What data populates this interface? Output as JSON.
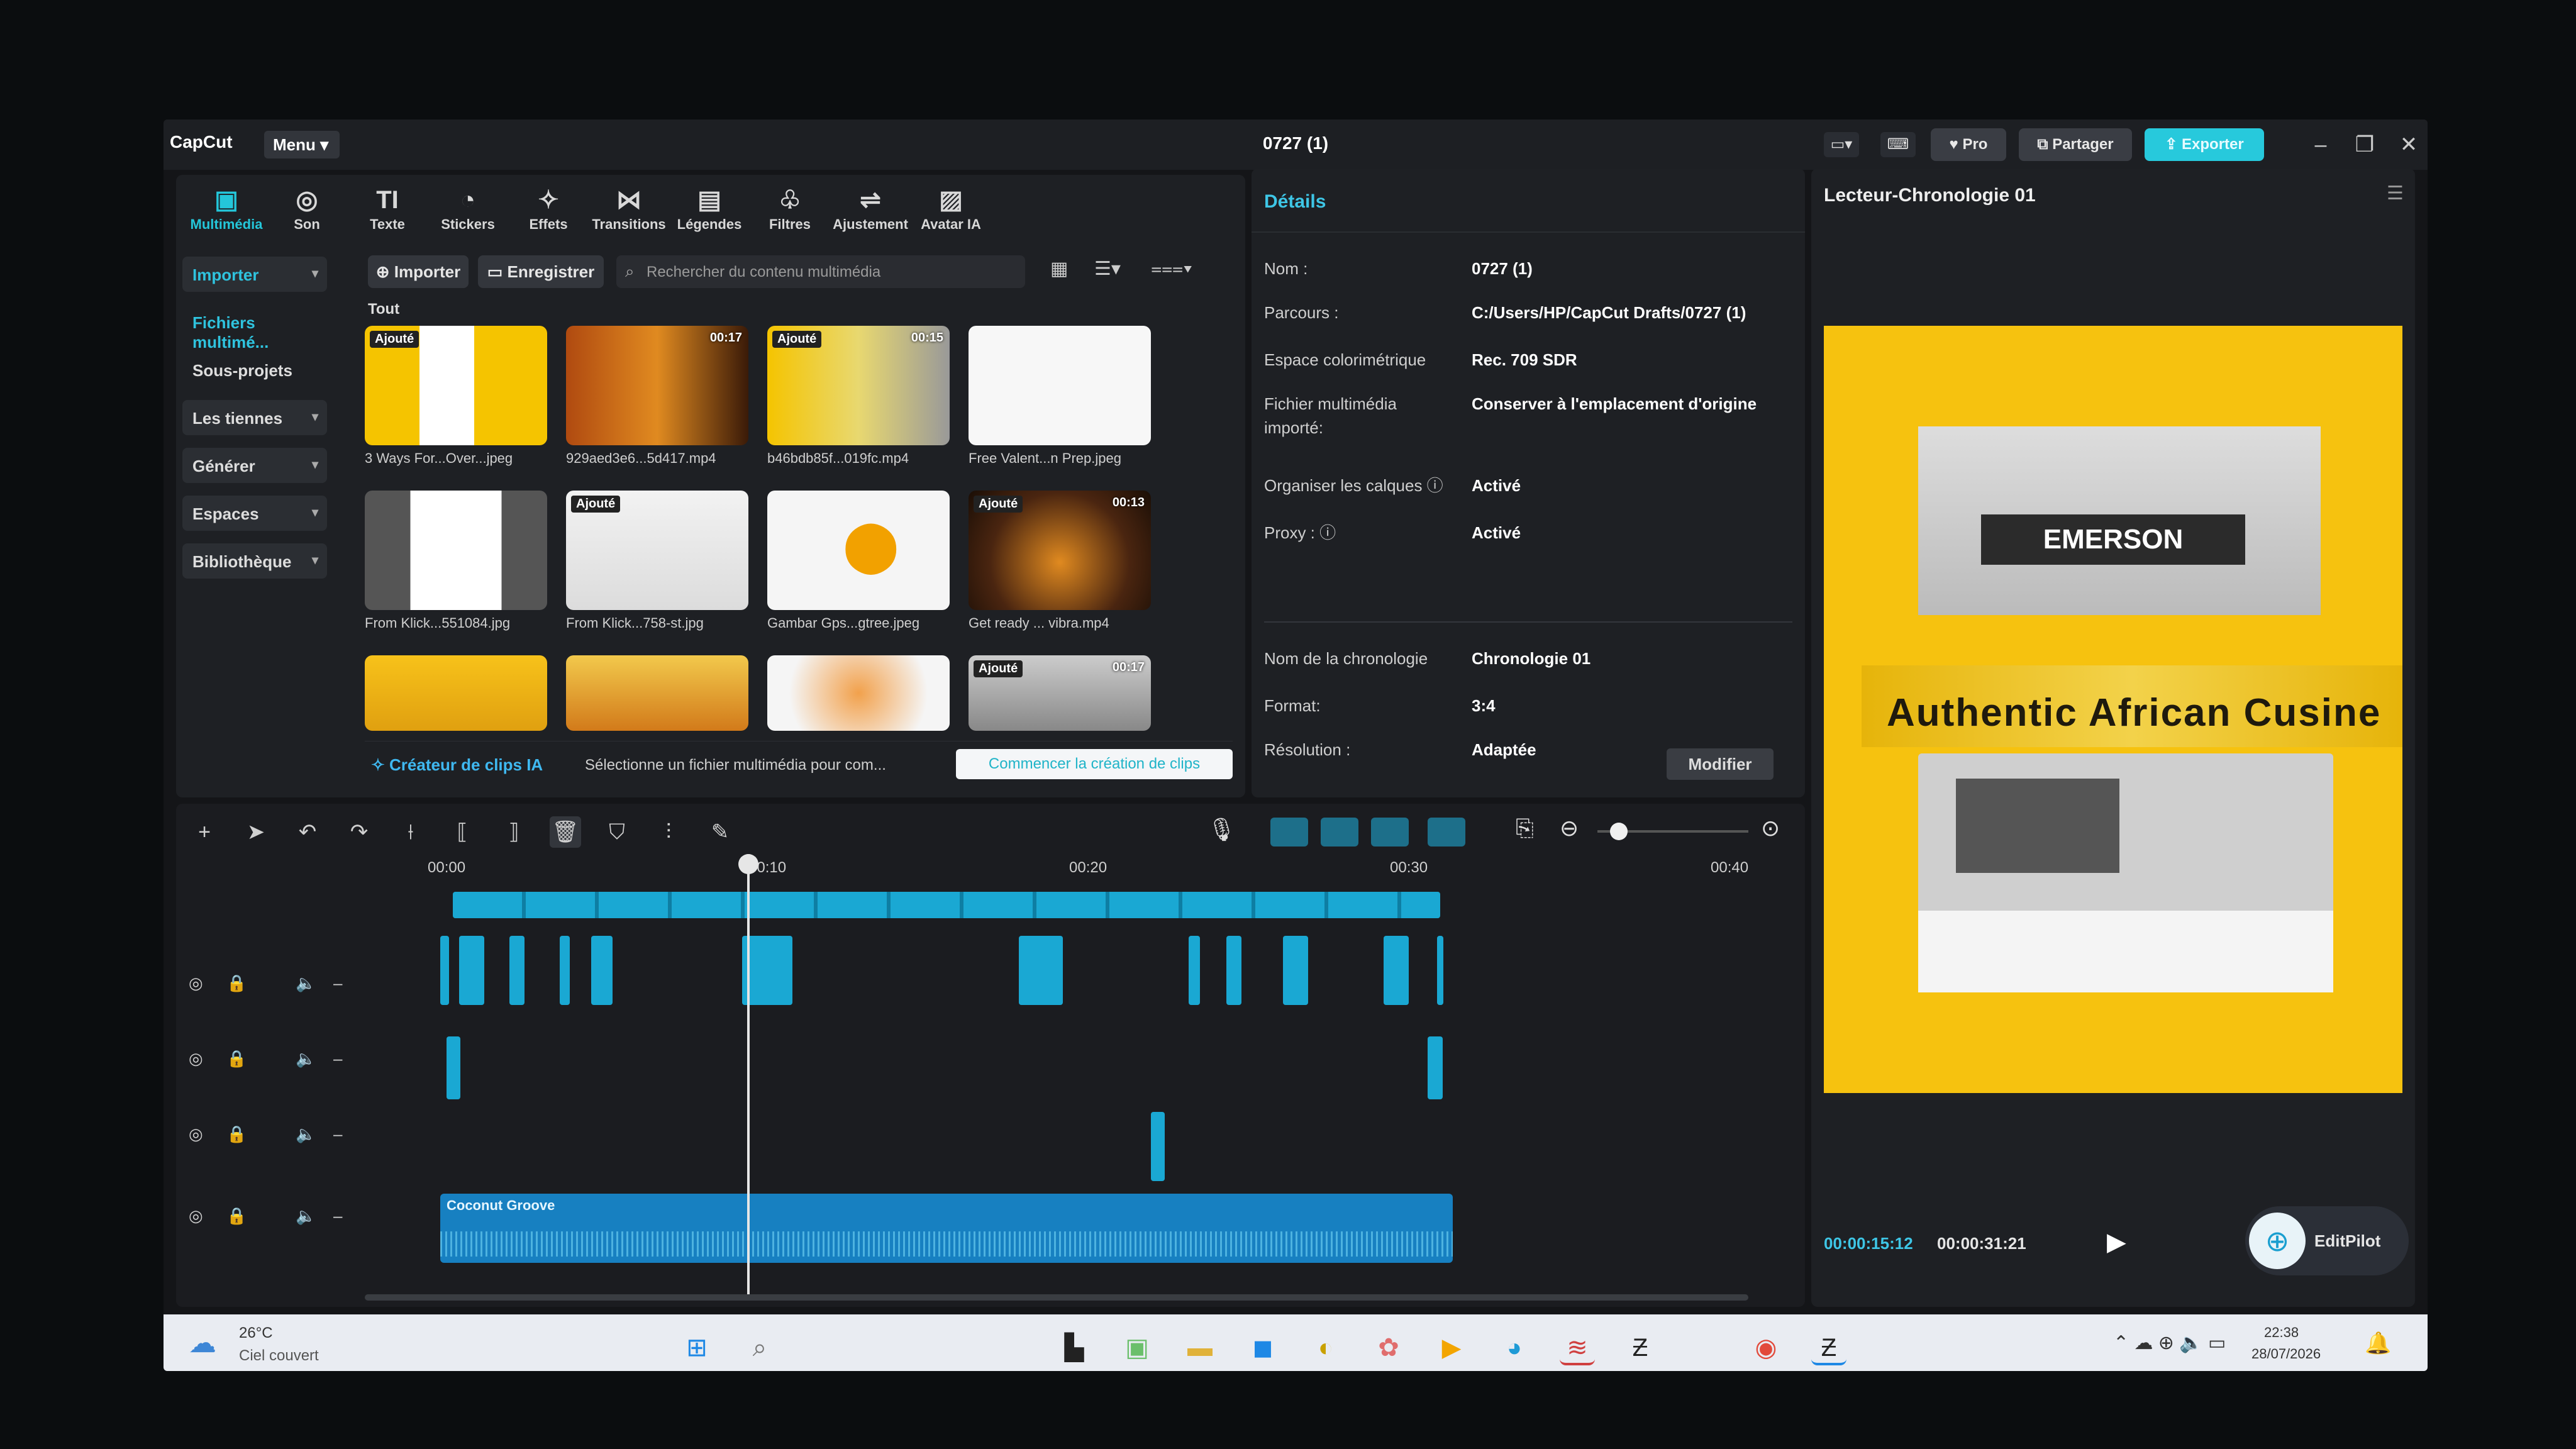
{
  "app": {
    "logo": "CapCut",
    "menu_label": "Menu",
    "project_title": "0727 (1)"
  },
  "titlebar": {
    "pro_label": "Pro",
    "share_label": "Partager",
    "export_label": "Exporter"
  },
  "toolbar": {
    "tabs": [
      {
        "label": "Multimédia",
        "icon": "media-icon",
        "glyph": "▣"
      },
      {
        "label": "Son",
        "icon": "audio-icon",
        "glyph": "◎"
      },
      {
        "label": "Texte",
        "icon": "text-icon",
        "glyph": "TI"
      },
      {
        "label": "Stickers",
        "icon": "sticker-icon",
        "glyph": "◔"
      },
      {
        "label": "Effets",
        "icon": "effects-icon",
        "glyph": "✧"
      },
      {
        "label": "Transitions",
        "icon": "transition-icon",
        "glyph": "⋈"
      },
      {
        "label": "Légendes",
        "icon": "captions-icon",
        "glyph": "▤"
      },
      {
        "label": "Filtres",
        "icon": "filter-icon",
        "glyph": "♧"
      },
      {
        "label": "Ajustement",
        "icon": "adjust-icon",
        "glyph": "⇌"
      },
      {
        "label": "Avatar IA",
        "icon": "avatar-icon",
        "glyph": "▨"
      }
    ]
  },
  "sidebar": {
    "items": [
      {
        "label": "Importer",
        "dropdown": true,
        "active": true
      },
      {
        "label": "Fichiers multimé...",
        "dropdown": false,
        "active": true
      },
      {
        "label": "Sous-projets",
        "dropdown": false
      },
      {
        "label": "Les tiennes",
        "dropdown": true
      },
      {
        "label": "Générer",
        "dropdown": true
      },
      {
        "label": "Espaces",
        "dropdown": true
      },
      {
        "label": "Bibliothèque",
        "dropdown": true
      }
    ]
  },
  "media": {
    "import_label": "Importer",
    "record_label": "Enregistrer",
    "search_placeholder": "Rechercher du contenu multimédia",
    "section_label": "Tout",
    "items": [
      {
        "name": "3 Ways For...Over...jpeg",
        "badge": "Ajouté",
        "duration": ""
      },
      {
        "name": "929aed3e6...5d417.mp4",
        "badge": "",
        "duration": "00:17"
      },
      {
        "name": "b46bdb85f...019fc.mp4",
        "badge": "Ajouté",
        "duration": "00:15"
      },
      {
        "name": "Free Valent...n Prep.jpeg",
        "badge": "",
        "duration": ""
      },
      {
        "name": "From Klick...551084.jpg",
        "badge": "",
        "duration": ""
      },
      {
        "name": "From Klick...758-st.jpg",
        "badge": "Ajouté",
        "duration": ""
      },
      {
        "name": "Gambar Gps...gtree.jpeg",
        "badge": "",
        "duration": ""
      },
      {
        "name": "Get ready ... vibra.mp4",
        "badge": "Ajouté",
        "duration": "00:13"
      },
      {
        "name": "",
        "badge": "",
        "duration": ""
      },
      {
        "name": "",
        "badge": "",
        "duration": ""
      },
      {
        "name": "",
        "badge": "",
        "duration": ""
      },
      {
        "name": "",
        "badge": "Ajouté",
        "duration": "00:17"
      }
    ],
    "ai_clips_label": "Créateur de clips IA",
    "ai_clips_hint": "Sélectionne un fichier multimédia pour com...",
    "ai_clips_button": "Commencer la création de clips"
  },
  "details": {
    "header": "Détails",
    "rows": [
      {
        "label": "Nom :",
        "value": "0727 (1)"
      },
      {
        "label": "Parcours :",
        "value": "C:/Users/HP/CapCut Drafts/0727 (1)"
      },
      {
        "label": "Espace colorimétrique",
        "value": "Rec. 709 SDR"
      },
      {
        "label": "Fichier multimédia importé:",
        "value": "Conserver à l'emplacement d'origine"
      },
      {
        "label": "Organiser les calques ⓘ",
        "value": "Activé"
      },
      {
        "label": "Proxy : ⓘ",
        "value": "Activé"
      },
      {
        "label": "Nom de la chronologie",
        "value": "Chronologie 01"
      },
      {
        "label": "Format:",
        "value": "3:4"
      },
      {
        "label": "Résolution :",
        "value": "Adaptée"
      }
    ],
    "modify_button": "Modifier"
  },
  "player": {
    "title": "Lecteur-Chronologie 01",
    "overlay_text": "Authentic African Cusine",
    "current_time": "00:00:15:12",
    "total_time": "00:00:31:21",
    "editpilot_label": "EditPilot"
  },
  "timeline": {
    "ruler": [
      "00:00",
      "00:10",
      "00:20",
      "00:30",
      "00:40"
    ],
    "audio_clip_label": "Coconut Groove",
    "playhead_fraction": 0.49
  },
  "taskbar": {
    "weather_temp": "26°C",
    "weather_desc": "Ciel couvert",
    "time": "22:38",
    "date": "28/07/2026"
  }
}
